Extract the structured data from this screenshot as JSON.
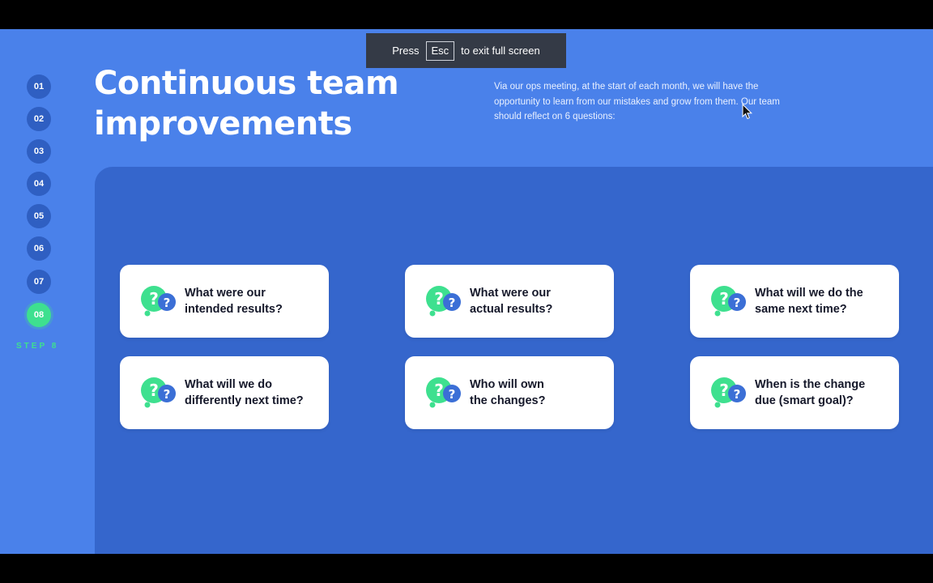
{
  "toast": {
    "press": "Press",
    "key": "Esc",
    "suffix": "to exit full screen"
  },
  "nav": {
    "steps": [
      "01",
      "02",
      "03",
      "04",
      "05",
      "06",
      "07",
      "08"
    ],
    "active_index": 7,
    "caption": "STEP 8"
  },
  "slide": {
    "title_line1": "Continuous team",
    "title_line2": "improvements",
    "intro": "Via our ops meeting, at the start of each month, we will have the opportunity to learn from our mistakes and grow from them. Our team should reflect on 6 questions:"
  },
  "questions": [
    "What were our\nintended results?",
    "What were our\nactual results?",
    "What will we do the\nsame next time?",
    "What will we do\ndifferently next time?",
    "Who will own\nthe changes?",
    "When is the change\ndue (smart goal)?"
  ],
  "icons": {
    "question": "question-bubbles-icon",
    "pointer": "mouse-pointer-icon"
  },
  "colors": {
    "background": "#4a81ea",
    "panel": "#3566cc",
    "accent_green": "#3ee08f",
    "step_dot": "#2f5fc2",
    "card": "#ffffff"
  }
}
